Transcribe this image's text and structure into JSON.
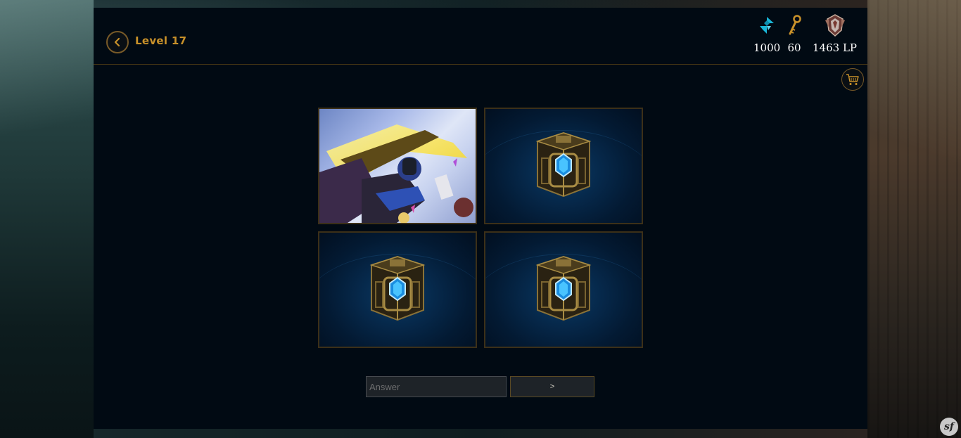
{
  "header": {
    "back_icon": "chevron-left-icon",
    "level_label": "Level 17"
  },
  "currencies": [
    {
      "icon": "blue-essence-icon",
      "value": "1000",
      "color": "#19b5d6"
    },
    {
      "icon": "hextech-key-icon",
      "value": "60",
      "color": "#c8912a"
    },
    {
      "icon": "rank-emblem-icon",
      "value": "1463 LP",
      "color": "#b8a0a0"
    }
  ],
  "cart": {
    "icon": "shopping-cart-icon"
  },
  "grid": {
    "tiles": [
      {
        "type": "splash-art",
        "revealed": true
      },
      {
        "type": "hextech-chest",
        "revealed": false
      },
      {
        "type": "hextech-chest",
        "revealed": false
      },
      {
        "type": "hextech-chest",
        "revealed": false
      }
    ]
  },
  "answer": {
    "placeholder": "Answer",
    "value": "",
    "submit_label": ">"
  },
  "badge": {
    "label": "sf"
  },
  "colors": {
    "panel_bg": "#010a13",
    "gold": "#c8912a",
    "gold_border": "#463714"
  }
}
